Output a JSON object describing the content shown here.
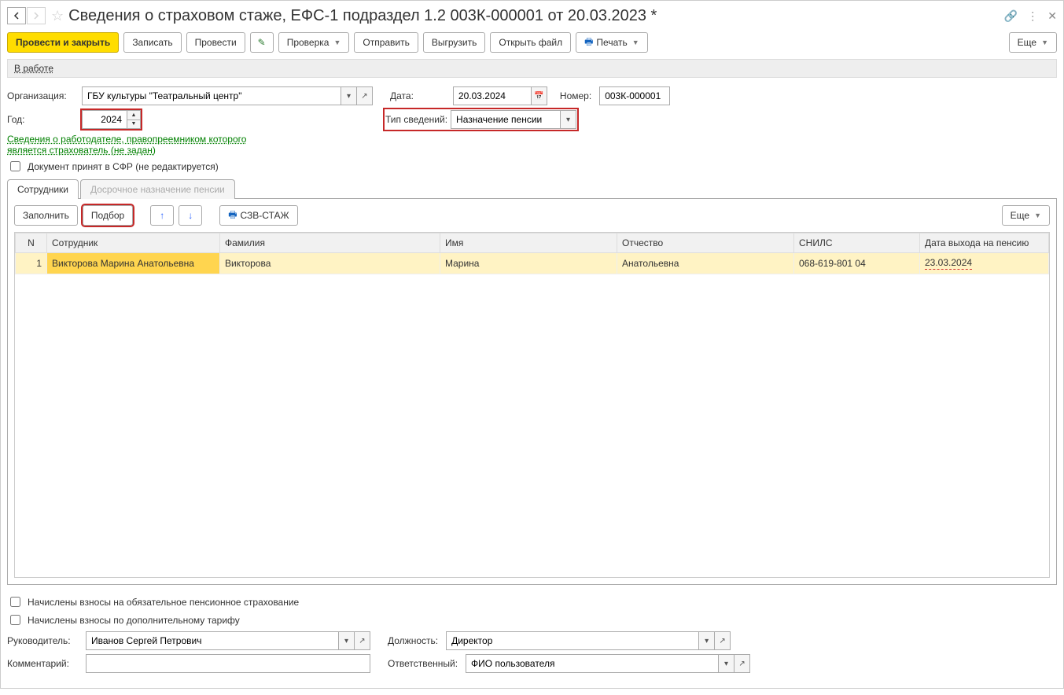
{
  "title": "Сведения о страховом стаже, ЕФС-1 подраздел 1.2 003К-000001 от 20.03.2023 *",
  "toolbar": {
    "postClose": "Провести и закрыть",
    "save": "Записать",
    "post": "Провести",
    "check": "Проверка",
    "send": "Отправить",
    "unload": "Выгрузить",
    "openFile": "Открыть файл",
    "print": "Печать",
    "more": "Еще"
  },
  "status": {
    "inWork": "В работе"
  },
  "form": {
    "orgLabel": "Организация:",
    "orgValue": "ГБУ культуры \"Театральный центр\"",
    "dateLabel": "Дата:",
    "dateValue": "20.03.2024",
    "numberLabel": "Номер:",
    "numberValue": "003К-000001",
    "yearLabel": "Год:",
    "yearValue": "2024",
    "typeLabel": "Тип сведений:",
    "typeValue": "Назначение пенсии",
    "predecessorLink1": "Сведения о работодателе, правопреемником которого",
    "predecessorLink2": "является страхователь (не задан)",
    "acceptedLabel": "Документ принят в СФР (не редактируется)"
  },
  "tabs": {
    "employees": "Сотрудники",
    "earlyPension": "Досрочное назначение пенсии"
  },
  "panelToolbar": {
    "fill": "Заполнить",
    "select": "Подбор",
    "szv": "СЗВ-СТАЖ",
    "more": "Еще"
  },
  "grid": {
    "columns": {
      "n": "N",
      "employee": "Сотрудник",
      "lastName": "Фамилия",
      "firstName": "Имя",
      "patronymic": "Отчество",
      "snils": "СНИЛС",
      "pensionDate": "Дата выхода на пенсию"
    },
    "rows": [
      {
        "n": "1",
        "employee": "Викторова Марина Анатольевна",
        "lastName": "Викторова",
        "firstName": "Марина",
        "patronymic": "Анатольевна",
        "snils": "068-619-801 04",
        "pensionDate": "23.03.2024"
      }
    ]
  },
  "bottom": {
    "cb1": "Начислены взносы на обязательное пенсионное страхование",
    "cb2": "Начислены взносы по дополнительному тарифу",
    "headLabel": "Руководитель:",
    "headValue": "Иванов Сергей Петрович",
    "positionLabel": "Должность:",
    "positionValue": "Директор",
    "commentLabel": "Комментарий:",
    "commentValue": "",
    "responsibleLabel": "Ответственный:",
    "responsibleValue": "ФИО пользователя"
  }
}
